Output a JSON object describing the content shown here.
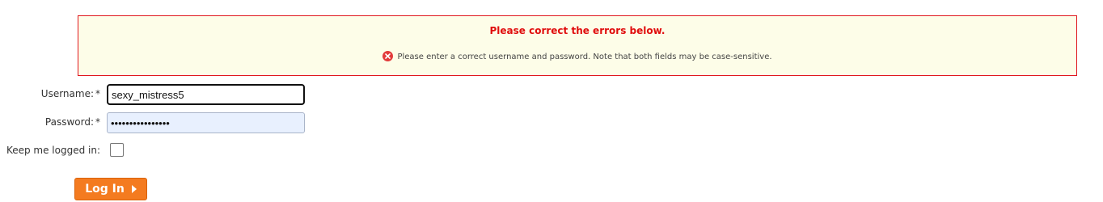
{
  "errors": {
    "title": "Please correct the errors below.",
    "message": "Please enter a correct username and password. Note that both fields may be case-sensitive."
  },
  "form": {
    "username_label": "Username:",
    "password_label": "Password:",
    "remember_label": "Keep me logged in:",
    "required_marker": "*",
    "username_value": "sexy_mistress5",
    "password_value": "••••••••••••••••",
    "remember_checked": false
  },
  "login_button": {
    "label": "Log In"
  },
  "colors": {
    "error_red": "#e00d0d",
    "error_bg": "#fdfde8",
    "button_orange": "#f47b20"
  },
  "icons": {
    "error": "error-circle-icon",
    "button_arrow": "caret-right-icon"
  }
}
